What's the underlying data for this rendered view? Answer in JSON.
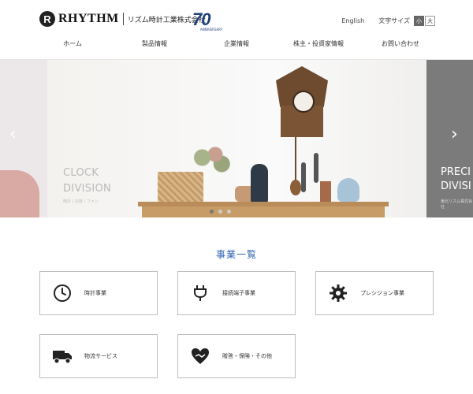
{
  "header": {
    "logo_mark": "R",
    "logo_text": "RHYTHM",
    "company_name": "リズム時計工業株式会社",
    "anniversary_number": "70",
    "anniversary_text": "ANNIVERSARY",
    "english_link": "English",
    "font_size_label": "文字サイズ",
    "font_size_small": "小",
    "font_size_large": "大"
  },
  "nav": {
    "items": [
      "ホーム",
      "製品情報",
      "企業情報",
      "株主・投資家情報",
      "お問い合わせ"
    ]
  },
  "hero": {
    "slide_title_line1": "CLOCK",
    "slide_title_line2": "DIVISION",
    "slide_subtitle": "時計 / お掛 / ファン",
    "next_title_line1": "PRECI",
    "next_title_line2": "DIVISI",
    "next_subtitle": "東北リズム株式会社",
    "prev_arrow": "‹",
    "next_arrow": "›",
    "dots_count": 3,
    "active_dot": 0
  },
  "business": {
    "title": "事業一覧",
    "cards": [
      {
        "label": "時計事業",
        "icon": "clock-icon"
      },
      {
        "label": "接続端子事業",
        "icon": "plug-icon"
      },
      {
        "label": "プレシジョン事業",
        "icon": "gear-icon"
      },
      {
        "label": "物流サービス",
        "icon": "truck-icon"
      },
      {
        "label": "贈答・保険・その他",
        "icon": "heart-hand-icon"
      }
    ]
  },
  "colors": {
    "accent_blue": "#2e62b2",
    "brand_navy": "#1f3f78",
    "card_border": "#bdbdbd",
    "hero_right_panel": "#7b7b7b"
  }
}
